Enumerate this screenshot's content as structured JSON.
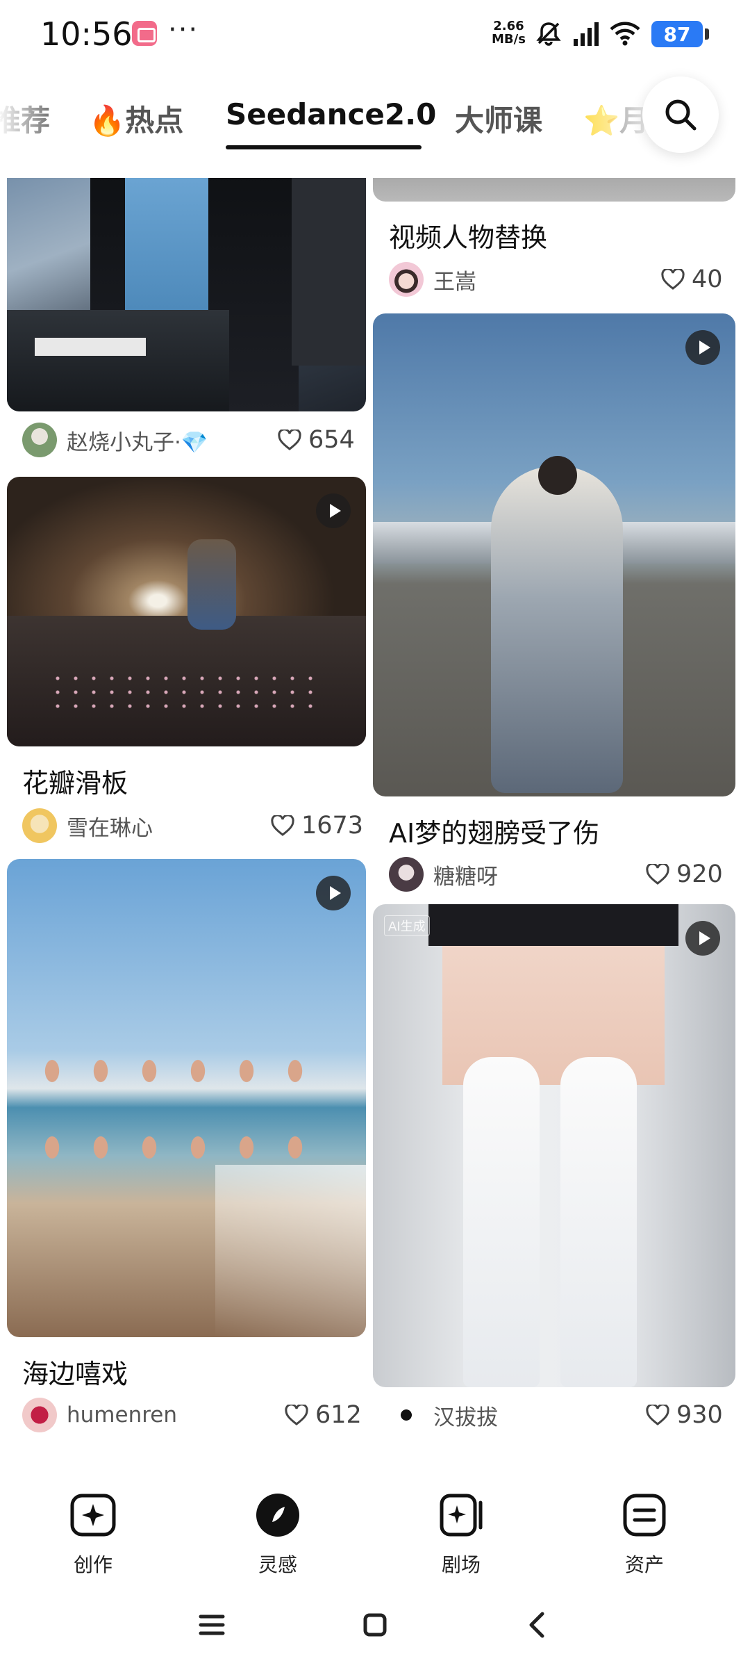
{
  "status_bar": {
    "time": "10:56",
    "net_speed_value": "2.66",
    "net_speed_unit": "MB/s",
    "battery": "87",
    "icons": [
      "app-notification-icon",
      "more-dots-icon",
      "mute-bell-icon",
      "signal-icon",
      "wifi-icon",
      "battery-icon"
    ]
  },
  "tabs": [
    {
      "label": "推荐",
      "visible": "推荐"
    },
    {
      "label": "🔥热点"
    },
    {
      "label": "Seedance2.0",
      "active": true
    },
    {
      "label": "大师课"
    },
    {
      "label": "⭐月"
    }
  ],
  "search": {
    "icon": "search-icon"
  },
  "feed": {
    "left": [
      {
        "title": "",
        "author": "赵烧小丸子·💎",
        "likes": "654",
        "has_play": false
      },
      {
        "title": "花瓣滑板",
        "author": "雪在琳心",
        "likes": "1673",
        "has_play": true
      },
      {
        "title": "海边嘻戏",
        "author": "humenren",
        "likes": "612",
        "has_play": true
      }
    ],
    "right": [
      {
        "title": "视频人物替换",
        "author": "王嵩",
        "likes": "40",
        "has_play": false
      },
      {
        "title": "AI梦的翅膀受了伤",
        "author": "糖糖呀",
        "likes": "920",
        "has_play": true
      },
      {
        "title": "",
        "author": "汉拔拔",
        "likes": "930",
        "has_play": true,
        "ai_tag": "AI生成"
      }
    ]
  },
  "bottom_nav": [
    {
      "label": "创作",
      "icon": "sparkle-create-icon"
    },
    {
      "label": "灵感",
      "icon": "compass-inspiration-icon"
    },
    {
      "label": "剧场",
      "icon": "theater-icon"
    },
    {
      "label": "资产",
      "icon": "assets-icon"
    }
  ],
  "system_nav": [
    "menu-icon",
    "home-icon",
    "back-icon"
  ],
  "colors": {
    "accent": "#111111",
    "battery": "#2a7af5",
    "like_icon": "#444444",
    "muted_text": "#555555"
  }
}
